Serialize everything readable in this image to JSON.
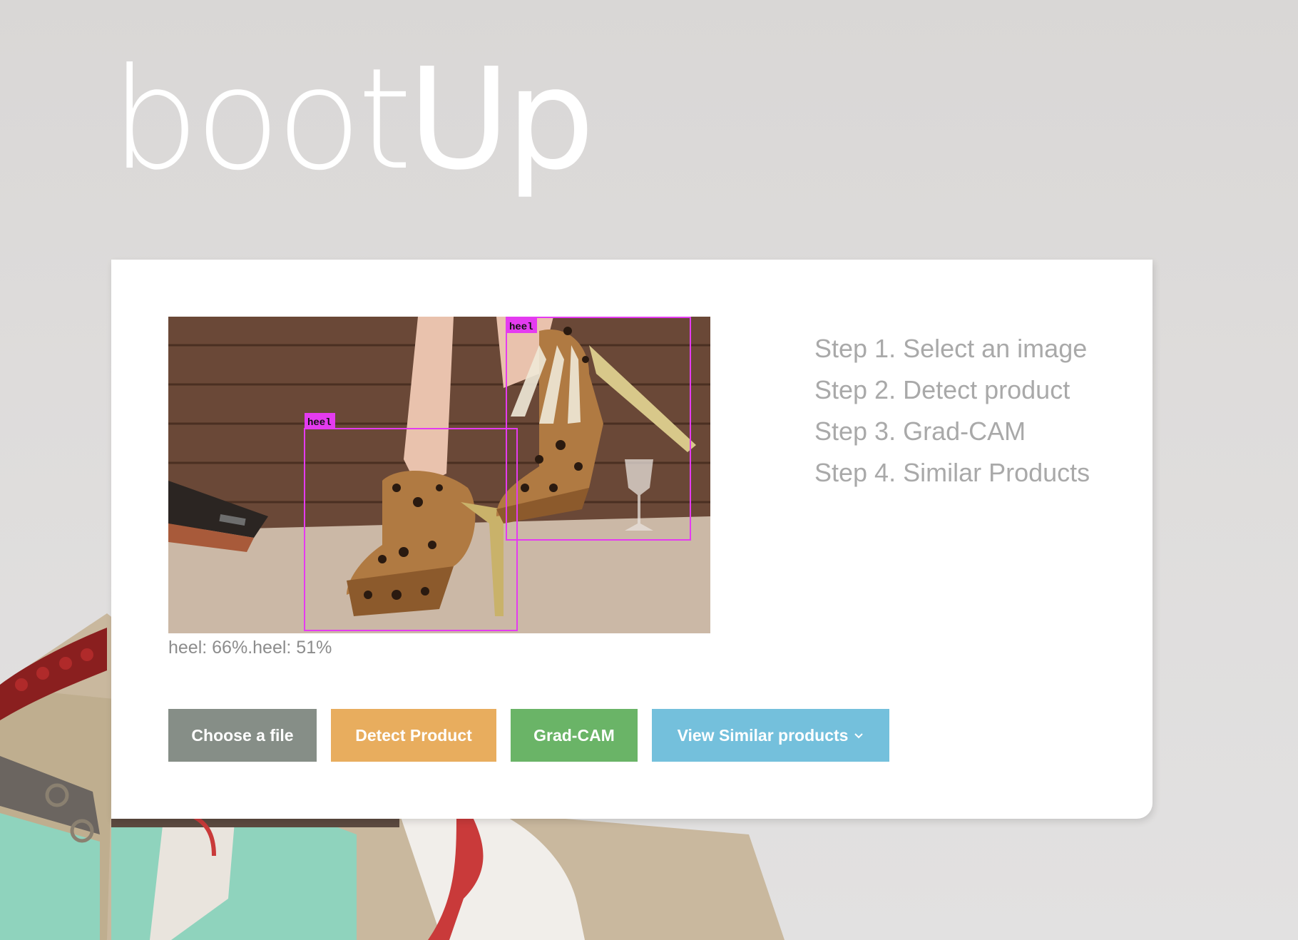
{
  "brand": {
    "prefix": "boot",
    "suffix": "Up"
  },
  "preview": {
    "detections": [
      {
        "label": "heel"
      },
      {
        "label": "heel"
      }
    ],
    "result_text": "heel: 66%.heel: 51%"
  },
  "steps": [
    "Step 1. Select an image",
    "Step 2. Detect product",
    "Step 3. Grad-CAM",
    "Step 4. Similar Products"
  ],
  "actions": {
    "choose_label": "Choose a file",
    "detect_label": "Detect Product",
    "gradcam_label": "Grad-CAM",
    "similar_label": "View Similar products"
  },
  "colors": {
    "choose": "#868e87",
    "detect": "#e8ad5e",
    "gradcam": "#6ab467",
    "similar": "#74c0dc",
    "bbox": "#e43bf0"
  },
  "icons": {
    "dropdown": "chevron-down-icon"
  }
}
